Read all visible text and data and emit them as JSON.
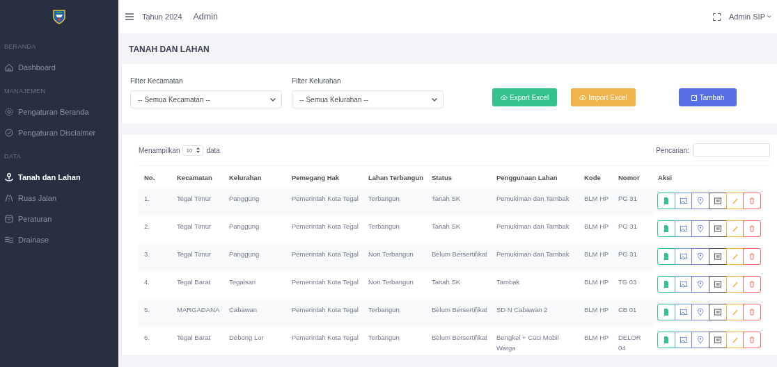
{
  "topbar": {
    "year_label": "Tahun 2024",
    "role": "Admin",
    "user": "Admin SIP"
  },
  "sidebar": {
    "sections": [
      {
        "label": "BERANDA",
        "items": [
          {
            "label": "Dashboard",
            "selected": false
          }
        ]
      },
      {
        "label": "MANAJEMEN",
        "items": [
          {
            "label": "Pengaturan Beranda",
            "selected": false
          },
          {
            "label": "Pengaturan Disclaimer",
            "selected": false
          }
        ]
      },
      {
        "label": "DATA",
        "items": [
          {
            "label": "Tanah dan Lahan",
            "selected": true
          },
          {
            "label": "Ruas Jalan",
            "selected": false
          },
          {
            "label": "Peraturan",
            "selected": false
          },
          {
            "label": "Drainase",
            "selected": false
          }
        ]
      }
    ]
  },
  "page_title": "TANAH DAN LAHAN",
  "filters": [
    {
      "label": "Filter Kecamatan",
      "value": "-- Semua Kecamatan --"
    },
    {
      "label": "Filter Kelurahan",
      "value": "-- Semua Kelurahan --"
    }
  ],
  "actions": [
    {
      "label": "Export Excel",
      "kind": "export"
    },
    {
      "label": "Import Excel",
      "kind": "import"
    },
    {
      "label": "Tambah",
      "kind": "add"
    }
  ],
  "table": {
    "length_prefix": "Menampilkan",
    "length_value": "10",
    "length_suffix": "data",
    "search_label": "Pencarian:",
    "columns": [
      "No.",
      "Kecamatan",
      "Kelurahan",
      "Pemegang Hak",
      "Lahan Terbangun",
      "Status",
      "Penggunaan Lahan",
      "Kode",
      "Nomor",
      "Aksi"
    ],
    "rows": [
      [
        "1.",
        "Tegal Timur",
        "Panggung",
        "Pemerintah Kota Tegal",
        "Terbangun",
        "Tanah SK",
        "Pemukiman dan Tambak",
        "BLM HP",
        "PG 31"
      ],
      [
        "2.",
        "Tegal Timur",
        "Panggung",
        "Pemerintah Kota Tegal",
        "Terbangun",
        "Tanah SK",
        "Pemukiman dan Tambak",
        "BLM HP",
        "PG 31"
      ],
      [
        "3.",
        "Tegal Timur",
        "Panggung",
        "Pemerintah Kota Tegal",
        "Non Terbangun",
        "Belum Bersertifikat",
        "Pemukiman dan Tambak",
        "BLM HP",
        "PG 31"
      ],
      [
        "4.",
        "Tegal Barat",
        "Tegalsari",
        "Pemerintah Kota Tegal",
        "Non Terbangun",
        "Tanah SK",
        "Tambak",
        "BLM HP",
        "TG 03"
      ],
      [
        "5.",
        "MARGADANA",
        "Cabawan",
        "Pemerintah Kota Tegal",
        "Terbangun",
        "Belum Bersertifikat",
        "SD N Cabawan 2",
        "BLM HP",
        "CB 01"
      ],
      [
        "6.",
        "Tegal Barat",
        "Debong Lor",
        "Pemerintah Kota Tegal",
        "Terbangun",
        "Belum Bersertifikat",
        "Bengkel + Cuci Mobil Warga",
        "BLM HP",
        "DELOR 04"
      ]
    ]
  }
}
